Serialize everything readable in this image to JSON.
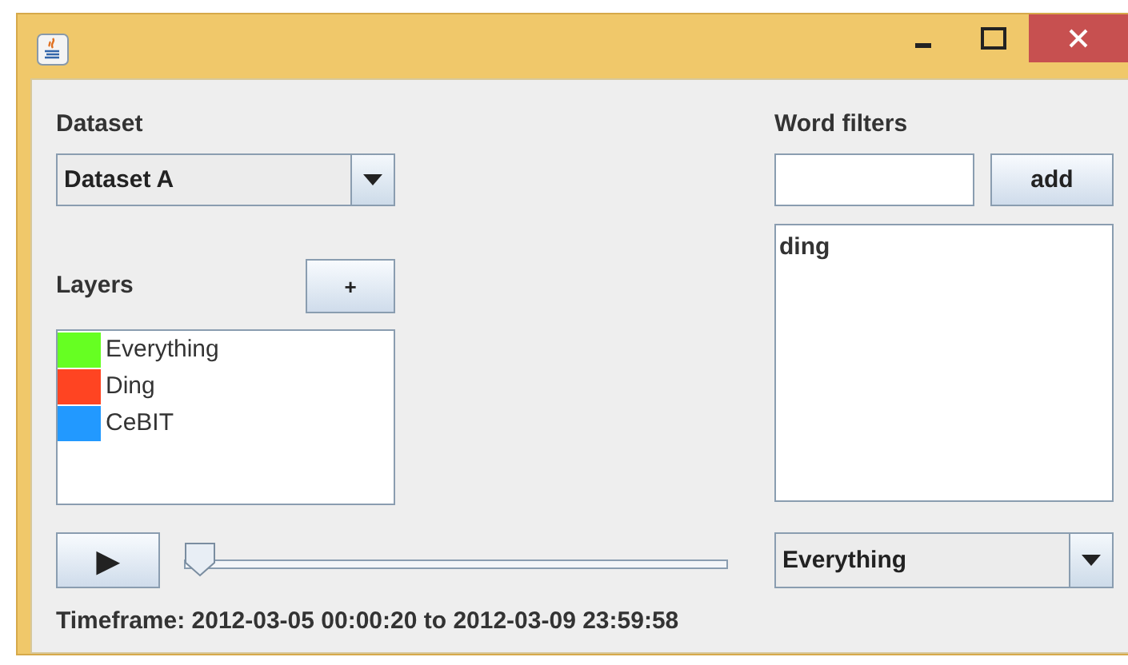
{
  "dataset": {
    "label": "Dataset",
    "value": "Dataset A"
  },
  "layers": {
    "label": "Layers",
    "add_button": "+",
    "items": [
      {
        "name": "Everything",
        "color": "#66ff22"
      },
      {
        "name": "Ding",
        "color": "#ff4422"
      },
      {
        "name": "CeBIT",
        "color": "#2299ff"
      }
    ]
  },
  "word_filters": {
    "label": "Word filters",
    "add_button": "add",
    "items": [
      "ding"
    ]
  },
  "playback": {
    "play_button": "▶",
    "slider": {
      "level": 0
    }
  },
  "layer_select": {
    "value": "Everything"
  },
  "timeframe": "Timeframe: 2012-03-05 00:00:20 to 2012-03-09 23:59:58"
}
